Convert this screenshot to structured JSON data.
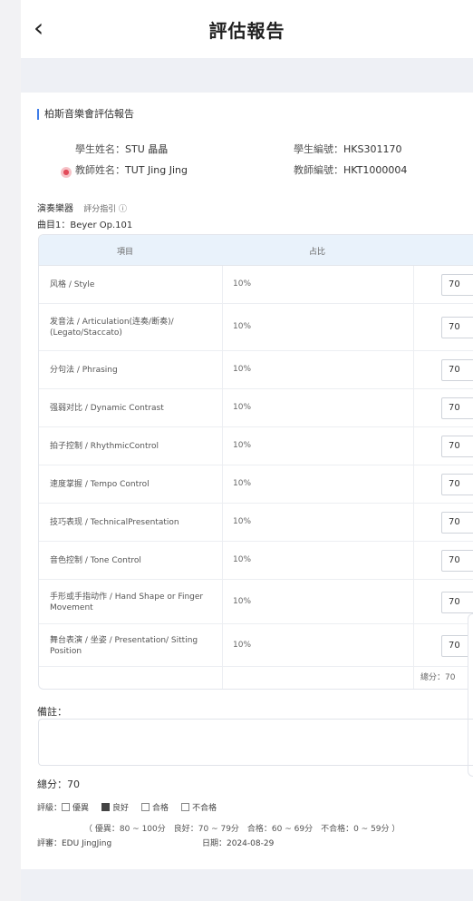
{
  "header": {
    "back_icon": "‹",
    "title": "評估報告"
  },
  "report": {
    "section_title": "柏斯音樂會評估報告",
    "student_name_label": "學生姓名：",
    "student_name": "STU 晶晶",
    "student_id_label": "學生編號：",
    "student_id": "HKS301170",
    "teacher_name_label": "教師姓名：",
    "teacher_name": "TUT Jing Jing",
    "teacher_id_label": "教師編號：",
    "teacher_id": "HKT1000004",
    "performance_label": "演奏樂器",
    "guide_label": "評分指引 ⓘ",
    "song": "曲目1：Beyer Op.101"
  },
  "table": {
    "headers": [
      "項目",
      "占比"
    ],
    "rows": [
      {
        "item": "风格 / Style",
        "pct": "10%",
        "score": "70"
      },
      {
        "item": "发音法 / Articulation(连奏/断奏)/ (Legato/Staccato)",
        "pct": "10%",
        "score": "70"
      },
      {
        "item": "分句法 / Phrasing",
        "pct": "10%",
        "score": "70"
      },
      {
        "item": "强弱对比 / Dynamic Contrast",
        "pct": "10%",
        "score": "70"
      },
      {
        "item": "拍子控制 / RhythmicControl",
        "pct": "10%",
        "score": "70"
      },
      {
        "item": "速度掌握 / Tempo Control",
        "pct": "10%",
        "score": "70"
      },
      {
        "item": "技巧表现 / TechnicalPresentation",
        "pct": "10%",
        "score": "70"
      },
      {
        "item": "音色控制 / Tone Control",
        "pct": "10%",
        "score": "70"
      },
      {
        "item": "手形或手指动作 / Hand Shape or Finger Movement",
        "pct": "10%",
        "score": "70"
      },
      {
        "item": "舞台表演 / 坐姿 / Presentation/ Sitting Position",
        "pct": "10%",
        "score": "70"
      }
    ],
    "total_label": "總分：70"
  },
  "remarks": {
    "label": "備註："
  },
  "summary": {
    "total": "總分：70",
    "grade_label": "評級：",
    "options": [
      "優異",
      "良好",
      "合格",
      "不合格"
    ],
    "selected": "良好",
    "range_text": "（ 優異：80 ~ 100分　良好：70 ~ 79分　合格：60 ~ 69分　不合格：0 ~ 59分 ）",
    "reviewer": "評審：EDU JingJing",
    "date": "日期：2024-08-29"
  }
}
